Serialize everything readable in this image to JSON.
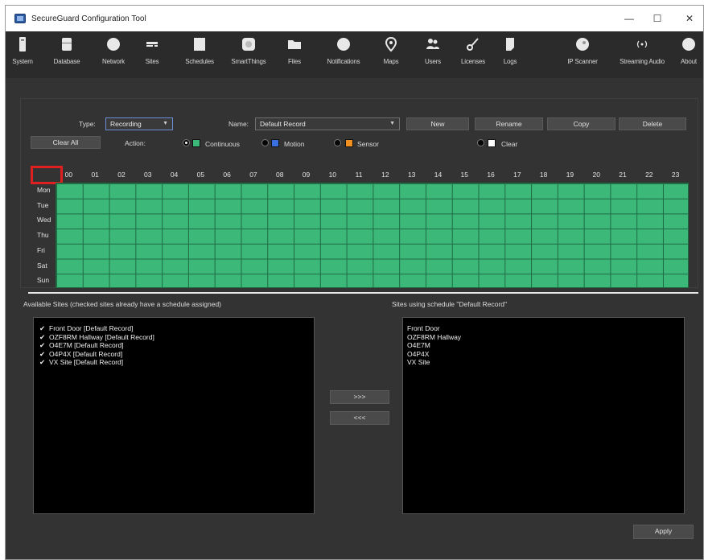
{
  "window": {
    "title": "SecureGuard Configuration Tool",
    "controls": {
      "minimize": "—",
      "maximize": "☐",
      "close": "✕"
    }
  },
  "toolbar": {
    "items": [
      {
        "label": "System",
        "icon": "system-icon"
      },
      {
        "label": "Database",
        "icon": "database-icon"
      },
      {
        "label": "Network",
        "icon": "network-icon"
      },
      {
        "label": "Sites",
        "icon": "sites-icon"
      },
      {
        "label": "Schedules",
        "icon": "schedules-icon"
      },
      {
        "label": "SmartThings",
        "icon": "smartthings-icon"
      },
      {
        "label": "Files",
        "icon": "folder-icon"
      },
      {
        "label": "Notifications",
        "icon": "notifications-icon"
      },
      {
        "label": "Maps",
        "icon": "map-pin-icon"
      },
      {
        "label": "Users",
        "icon": "users-icon"
      },
      {
        "label": "Licenses",
        "icon": "key-icon"
      },
      {
        "label": "Logs",
        "icon": "logs-icon"
      },
      {
        "label": "IP Scanner",
        "icon": "ip-scanner-icon"
      },
      {
        "label": "Streaming Audio",
        "icon": "streaming-audio-icon"
      },
      {
        "label": "About",
        "icon": "about-icon"
      }
    ]
  },
  "schedule": {
    "type_label": "Type:",
    "type_value": "Recording",
    "name_label": "Name:",
    "name_value": "Default Record",
    "buttons": {
      "new": "New",
      "rename": "Rename",
      "copy": "Copy",
      "delete": "Delete",
      "clear_all": "Clear All"
    },
    "action_label": "Action:",
    "actions": [
      {
        "label": "Continuous",
        "color": "#3cb878",
        "selected": true
      },
      {
        "label": "Motion",
        "color": "#3b6fe0",
        "selected": false
      },
      {
        "label": "Sensor",
        "color": "#f0901e",
        "selected": false
      },
      {
        "label": "Clear",
        "color": "#ffffff",
        "selected": false
      }
    ],
    "hours": [
      "00",
      "01",
      "02",
      "03",
      "04",
      "05",
      "06",
      "07",
      "08",
      "09",
      "10",
      "11",
      "12",
      "13",
      "14",
      "15",
      "16",
      "17",
      "18",
      "19",
      "20",
      "21",
      "22",
      "23"
    ],
    "days": [
      "Mon",
      "Tue",
      "Wed",
      "Thu",
      "Fri",
      "Sat",
      "Sun"
    ],
    "fill_action": "Continuous"
  },
  "sites": {
    "available_title": "Available Sites (checked sites already have a schedule assigned)",
    "available": [
      {
        "label": "Front Door [Default Record]",
        "checked": true
      },
      {
        "label": "OZF8RM Hallway [Default Record]",
        "checked": true
      },
      {
        "label": "O4E7M [Default Record]",
        "checked": true
      },
      {
        "label": "O4P4X [Default Record]",
        "checked": true
      },
      {
        "label": "VX Site [Default Record]",
        "checked": true
      }
    ],
    "using_title": "Sites using schedule \"Default Record\"",
    "using": [
      "Front Door",
      "OZF8RM Hallway",
      "O4E7M",
      "O4P4X",
      "VX Site"
    ],
    "add_button": ">>>",
    "remove_button": "<<<",
    "checkmark": "✔"
  },
  "footer": {
    "apply": "Apply"
  }
}
